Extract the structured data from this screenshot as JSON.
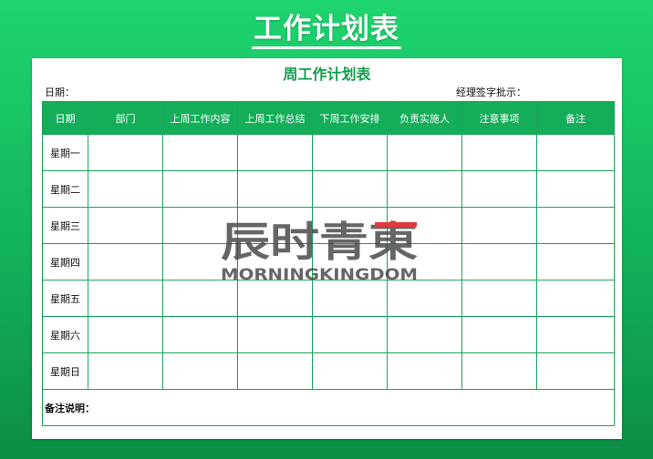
{
  "title": "工作计划表",
  "sheet": {
    "title": "周工作计划表",
    "date_label": "日期：",
    "approval_label": "经理签字批示：",
    "headers": [
      "日期",
      "部门",
      "上周工作内容",
      "上周工作总结",
      "下周工作安排",
      "负责实施人",
      "注意事项",
      "备注"
    ],
    "days": [
      "星期一",
      "星期二",
      "星期三",
      "星期四",
      "星期五",
      "星期六",
      "星期日"
    ],
    "note_label": "备注说明："
  },
  "watermark": {
    "cn_text": "辰时青東",
    "en_text": "MORNINGKINGDOM"
  },
  "colors": {
    "background": "#14c161",
    "header_fill": "#14ad58",
    "title_green": "#129c4d",
    "watermark_gray": "#4a4a4a",
    "watermark_red": "#e6373d"
  }
}
